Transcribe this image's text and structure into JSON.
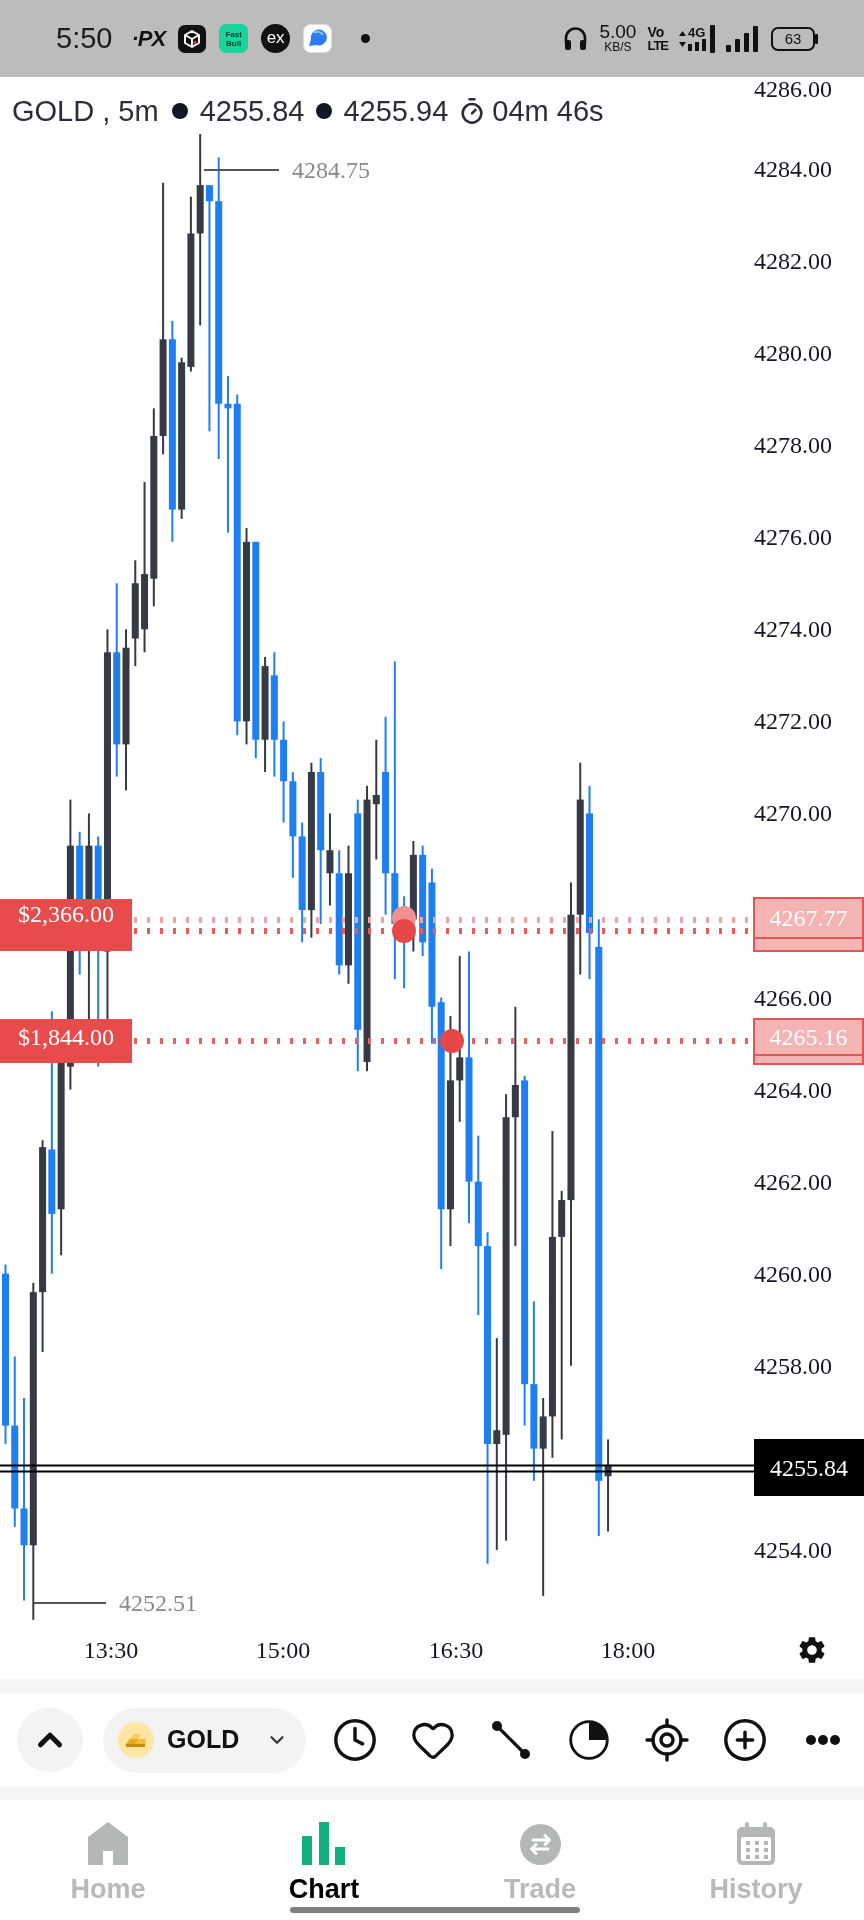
{
  "status_bar": {
    "time": "5:50",
    "notification_icons": [
      {
        "kind": "logo",
        "text": "·PX"
      },
      {
        "kind": "cube"
      },
      {
        "kind": "tile",
        "text": "Fast Bull"
      },
      {
        "kind": "disc",
        "text": "ex"
      },
      {
        "kind": "bubble"
      },
      {
        "kind": "dot"
      }
    ],
    "net_speed": {
      "value": "5.00",
      "unit": "KB/S"
    },
    "volte": {
      "top": "Vo",
      "bottom": "LTE"
    },
    "network": "4G",
    "battery": "63"
  },
  "chart_header": {
    "title": "GOLD , 5m",
    "bid": "4255.84",
    "ask": "4255.94",
    "countdown": "04m 46s"
  },
  "chart": {
    "price_axis": [
      "4286.00",
      "4284.00",
      "4282.00",
      "4280.00",
      "4278.00",
      "4276.00",
      "4274.00",
      "4272.00",
      "4270.00",
      "4266.00",
      "4264.00",
      "4262.00",
      "4260.00",
      "4258.00",
      "4254.00"
    ],
    "time_axis": [
      "13:30",
      "15:00",
      "16:30",
      "18:00"
    ],
    "high_label": "4284.75",
    "low_label": "4252.51",
    "orders": [
      {
        "amount": "$2,366.00",
        "price": "4267.77"
      },
      {
        "amount": "$1,844.00",
        "price": "4265.16"
      }
    ],
    "current_price": "4255.84"
  },
  "toolbar": {
    "symbol": "GOLD"
  },
  "bottom_nav": [
    {
      "label": "Home",
      "selected": false
    },
    {
      "label": "Chart",
      "selected": true
    },
    {
      "label": "Trade",
      "selected": false
    },
    {
      "label": "History",
      "selected": false
    }
  ]
}
